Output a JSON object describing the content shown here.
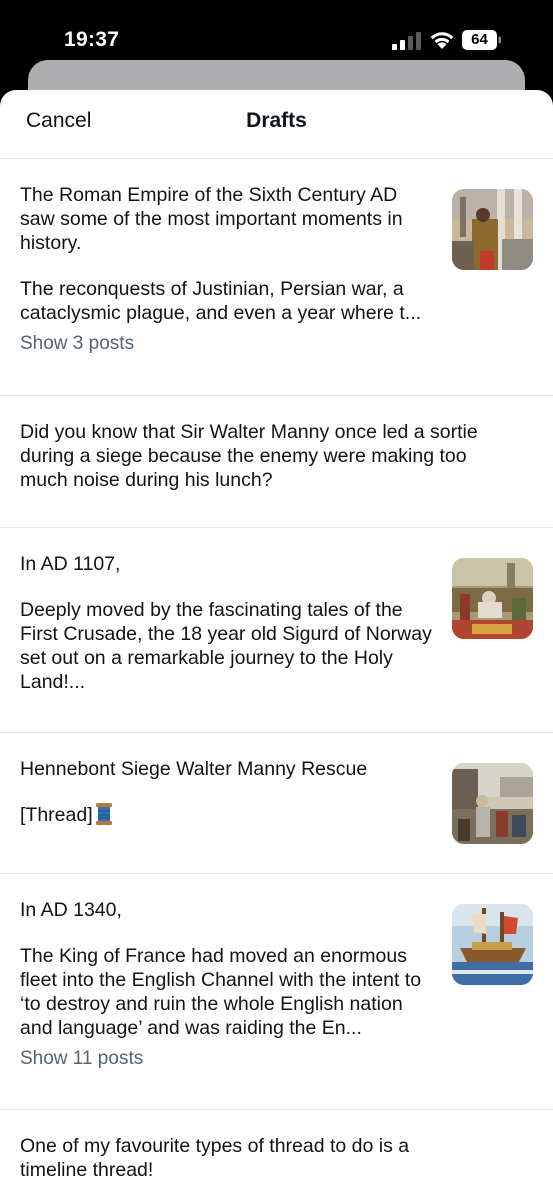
{
  "status": {
    "time": "19:37",
    "battery": "64"
  },
  "header": {
    "cancel_label": "Cancel",
    "title": "Drafts"
  },
  "drafts": [
    {
      "paragraphs": [
        "The Roman Empire of the Sixth Century AD saw some of the most important moments in history.",
        "The reconquests of Justinian, Persian war, a cataclysmic plague, and even a year where t..."
      ],
      "show_label": "Show 3 posts",
      "thumbnail": "roman-court-painting"
    },
    {
      "paragraphs": [
        "Did you know that Sir Walter Manny once led a sortie during a siege because the enemy were making too much noise during his lunch?"
      ]
    },
    {
      "paragraphs": [
        "In AD 1107,",
        "Deeply moved by the fascinating tales of the First Crusade, the 18 year old Sigurd of Norway set out on a remarkable journey to the Holy Land!..."
      ],
      "thumbnail": "sigurd-procession-painting"
    },
    {
      "paragraphs": [
        "Hennebont Siege Walter Manny Rescue",
        "[Thread]"
      ],
      "emoji": "spool-of-thread-icon",
      "thumbnail": "hennebont-siege-painting"
    },
    {
      "paragraphs": [
        "In AD 1340,",
        "The King of France had moved an enormous fleet into the English Channel with the intent to ‘to destroy and ruin the whole English nation and language’ and was raiding the En..."
      ],
      "show_label": "Show 11 posts",
      "thumbnail": "naval-battle-painting"
    },
    {
      "paragraphs": [
        "One of my favourite types of thread to do is a timeline thread!"
      ]
    }
  ]
}
